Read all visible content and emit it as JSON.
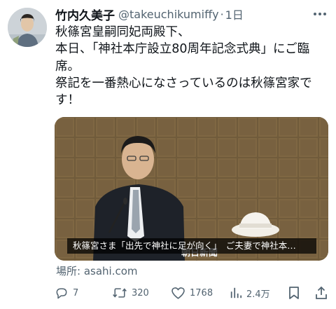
{
  "user": {
    "display_name": "竹内久美子",
    "handle": "@takeuchikumiffy",
    "separator": "·",
    "time": "1日"
  },
  "tweet": {
    "lines": [
      "秋篠宮皇嗣同妃両殿下、",
      "本日、「神社本庁設立80周年記念式典」にご臨",
      "席。",
      "祭記を一番熱心になさっているのは秋篠宮家で",
      "す！"
    ]
  },
  "media": {
    "caption": "秋篠宮さま「出先で神社に足が向く」　ご夫妻で神社本…",
    "watermark": "朝日新聞"
  },
  "location": {
    "label": "場所:",
    "source": "asahi.com"
  },
  "actions": {
    "replies": "7",
    "reposts": "320",
    "likes": "1768",
    "views": "2.4万"
  },
  "icons": {
    "more": "more-icon",
    "reply": "reply-icon",
    "repost": "repost-icon",
    "like": "like-icon",
    "views": "views-icon",
    "bookmark": "bookmark-icon",
    "share": "share-icon"
  },
  "colors": {
    "text": "#0f1419",
    "secondary": "#536471",
    "background": "#ffffff"
  }
}
